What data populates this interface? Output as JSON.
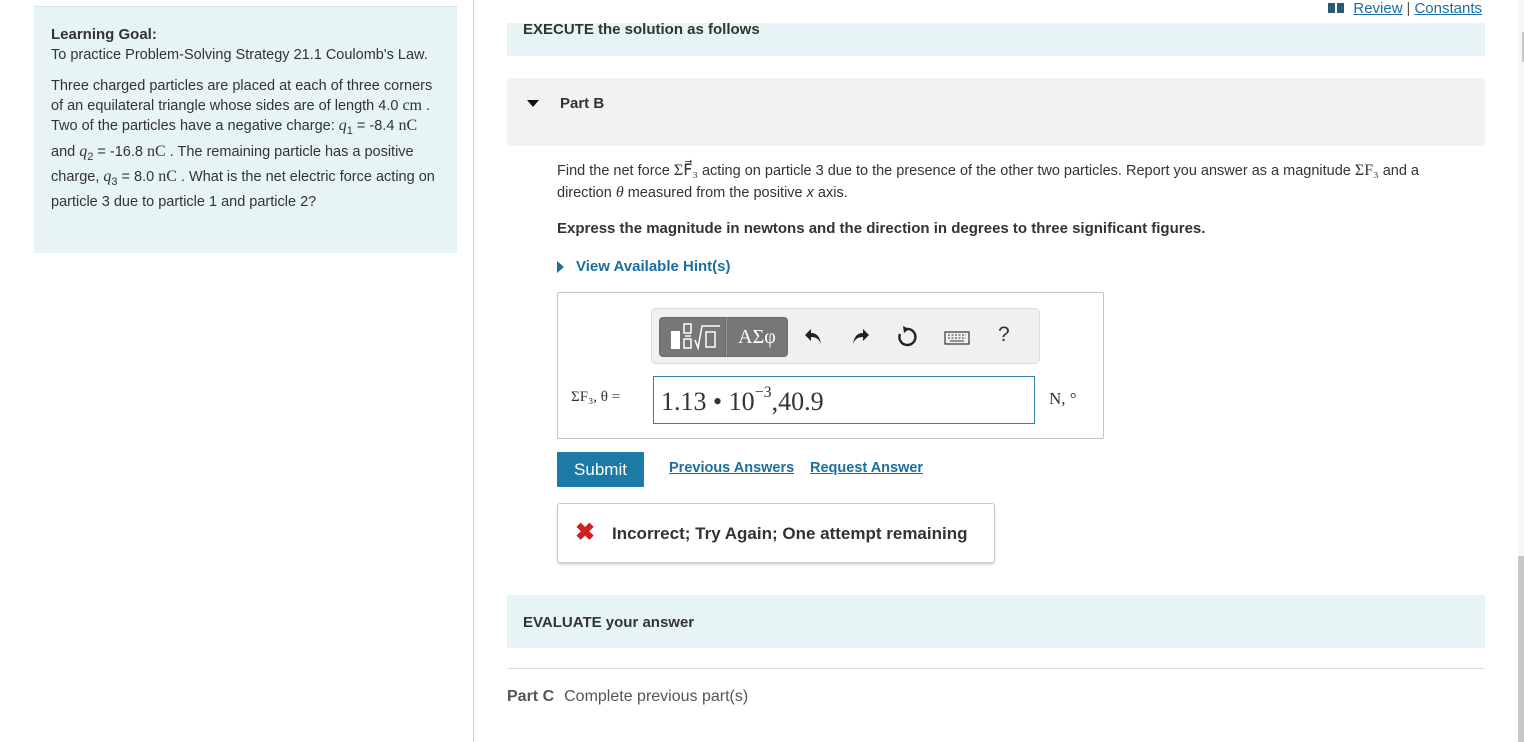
{
  "header": {
    "review_label": "Review",
    "separator": "|",
    "constants_label": "Constants"
  },
  "learning_goal": {
    "title": "Learning Goal:",
    "text": "To practice Problem-Solving Strategy 21.1 Coulomb's Law.",
    "problem": {
      "p1": "Three charged particles are placed at each of three corners of an equilateral triangle whose sides are of length 4.0 ",
      "unit_cm": "cm",
      "p2": " . Two of the particles have a negative charge: ",
      "q1_sym": "q",
      "q1_sub": "1",
      "q1_val": " = -8.4 ",
      "unit_nc1": "nC",
      "p3": " and ",
      "q2_sym": "q",
      "q2_sub": "2",
      "q2_val": " = -16.8 ",
      "unit_nc2": "nC",
      "p4": " . The remaining particle has a positive charge, ",
      "q3_sym": "q",
      "q3_sub": "3",
      "q3_val": " = 8.0 ",
      "unit_nc3": "nC",
      "p5": " . What is the net electric force acting on particle 3 due to particle 1 and particle 2?"
    }
  },
  "execute": {
    "label": "EXECUTE the solution as follows"
  },
  "part_b": {
    "label": "Part B",
    "question_a": "Find the net force ",
    "sigma_f3": "ΣF⃗₃",
    "question_b": " acting on particle 3 due to the presence of the other two particles. Report you answer as a magnitude ",
    "sigma_f3_mag": "ΣF₃",
    "question_c": " and a direction ",
    "theta": "θ",
    "question_d": " measured from the positive ",
    "x": "x",
    "question_e": " axis.",
    "express": "Express the magnitude in newtons and the direction in degrees to three significant figures.",
    "hints_label": "View Available Hint(s)",
    "toolbar": {
      "greek_label": "ΑΣφ",
      "undo_icon": "undo-icon",
      "redo_icon": "redo-icon",
      "reset_icon": "reset-icon",
      "keyboard_icon": "keyboard-icon",
      "help_label": "?"
    },
    "answer_label": "ΣF₃, θ =",
    "answer_value": {
      "mantissa": "1.13 • 10",
      "exponent": "−3",
      "rest": ",40.9"
    },
    "units": "N, °",
    "submit_label": "Submit",
    "previous_answers_label": "Previous Answers",
    "request_answer_label": "Request Answer",
    "feedback": "Incorrect; Try Again; One attempt remaining"
  },
  "evaluate": {
    "label": "EVALUATE your answer"
  },
  "part_c": {
    "label": "Part C",
    "status": "Complete previous part(s)"
  }
}
